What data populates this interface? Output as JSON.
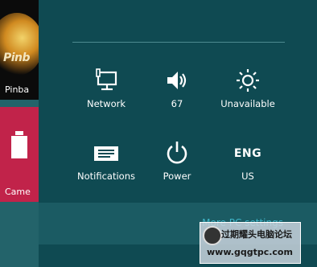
{
  "start_tiles": [
    {
      "label": "Pinba",
      "logo_text": "Pinb"
    },
    {
      "label": "Came"
    }
  ],
  "quick_settings_row1": [
    {
      "label": "Network",
      "icon": "network-icon"
    },
    {
      "label": "67",
      "icon": "volume-icon"
    },
    {
      "label": "Unavailable",
      "icon": "brightness-icon"
    }
  ],
  "quick_settings_row2": [
    {
      "label": "Notifications",
      "icon": "notifications-icon"
    },
    {
      "label": "Power",
      "icon": "power-icon"
    },
    {
      "label": "US",
      "icon_text": "ENG"
    }
  ],
  "footer": {
    "more_link": "More PC settings"
  },
  "watermark": {
    "line1": "过期耀头电脑论坛",
    "line2": "www.gqgtpc.com"
  },
  "colors": {
    "panel": "#0f4a52",
    "accent_link": "#3fb5c8",
    "camera_tile": "#c1234a"
  }
}
